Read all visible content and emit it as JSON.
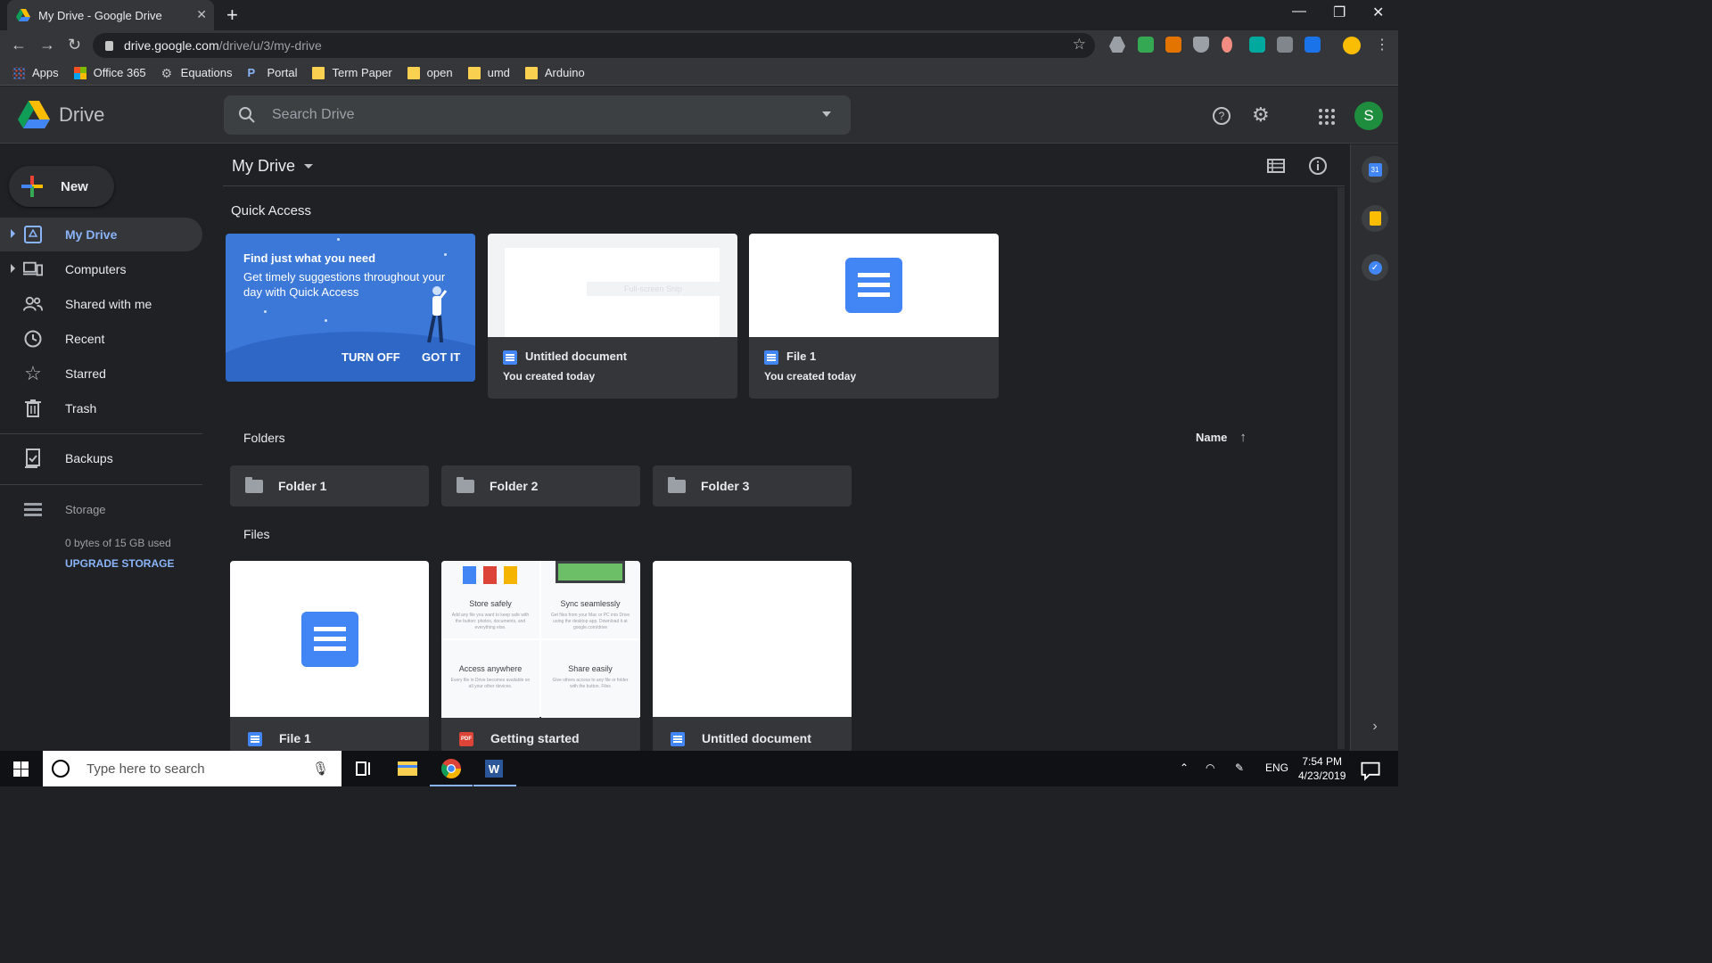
{
  "browser": {
    "tab_title": "My Drive - Google Drive",
    "url_host": "drive.google.com",
    "url_path": "/drive/u/3/my-drive",
    "bookmarks": [
      "Apps",
      "Office 365",
      "Equations",
      "Portal",
      "Term Paper",
      "open",
      "umd",
      "Arduino"
    ]
  },
  "header": {
    "app_name": "Drive",
    "search_placeholder": "Search Drive",
    "avatar_letter": "S"
  },
  "sidebar": {
    "new_label": "New",
    "items": [
      {
        "label": "My Drive",
        "icon": "my-drive-icon"
      },
      {
        "label": "Computers",
        "icon": "computers-icon"
      },
      {
        "label": "Shared with me",
        "icon": "shared-icon"
      },
      {
        "label": "Recent",
        "icon": "clock-icon"
      },
      {
        "label": "Starred",
        "icon": "star-icon"
      },
      {
        "label": "Trash",
        "icon": "trash-icon"
      },
      {
        "label": "Backups",
        "icon": "backups-icon"
      }
    ],
    "storage_label": "Storage",
    "storage_used": "0 bytes of 15 GB used",
    "upgrade_label": "UPGRADE STORAGE"
  },
  "main": {
    "title": "My Drive",
    "quick_access_title": "Quick Access",
    "promo": {
      "title": "Find just what you need",
      "text": "Get timely suggestions throughout your day with Quick Access",
      "turn_off": "TURN OFF",
      "got_it": "GOT IT"
    },
    "quick_cards": [
      {
        "name": "Untitled document",
        "sub": "You created today",
        "thumb_text": "Full-screen Snip"
      },
      {
        "name": "File 1",
        "sub": "You created today"
      }
    ],
    "folders_title": "Folders",
    "sort_label": "Name",
    "folders": [
      "Folder 1",
      "Folder 2",
      "Folder 3"
    ],
    "files_title": "Files",
    "files": [
      {
        "name": "File 1",
        "type": "doc"
      },
      {
        "name": "Getting started",
        "type": "pdf"
      },
      {
        "name": "Untitled document",
        "type": "doc"
      }
    ],
    "getting_started": {
      "cells": [
        {
          "heading": "Store safely",
          "text": "Add any file you want to keep safe with the button: photos, documents, and everything else."
        },
        {
          "heading": "Sync seamlessly",
          "text": "Get files from your Mac or PC into Drive using the desktop app. Download it at google.com/drive"
        },
        {
          "heading": "Access anywhere",
          "text": "Every file in Drive becomes available on all your other devices."
        },
        {
          "heading": "Share easily",
          "text": "Give others access to any file or folder with the button. Files"
        }
      ]
    }
  },
  "taskbar": {
    "search_placeholder": "Type here to search",
    "lang": "ENG",
    "time": "7:54 PM",
    "date": "4/23/2019"
  },
  "colors": {
    "accent_blue": "#8ab4f8",
    "doc_blue": "#4285f4",
    "promo_blue": "#3c78d8",
    "avatar_green": "#1e8e3e"
  }
}
